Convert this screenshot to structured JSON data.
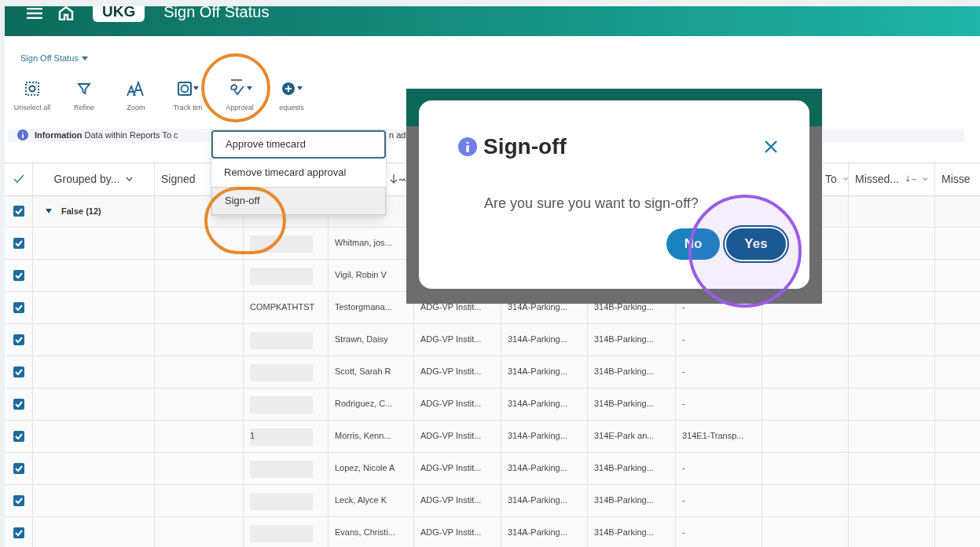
{
  "header": {
    "logo": "UKG",
    "title": "Sign Off Status"
  },
  "view_selector": {
    "label": "Sign Off Status"
  },
  "toolbar": [
    {
      "label": "Unselect all",
      "kind": "unselect",
      "menu": false
    },
    {
      "label": "Refine",
      "kind": "filter",
      "menu": false
    },
    {
      "label": "Zoom",
      "kind": "zoom",
      "menu": false
    },
    {
      "label": "Track tim",
      "kind": "track",
      "menu": true
    },
    {
      "label": "Approval",
      "kind": "approval",
      "menu": true
    },
    {
      "label": "equests",
      "kind": "add",
      "menu": true
    }
  ],
  "info_bar": {
    "text": "**Information** Data within Reports To c",
    "text_2": "n ad"
  },
  "approval_menu": [
    {
      "label": "Approve timecard",
      "focused": true,
      "selected": false
    },
    {
      "label": "Remove timecard approval",
      "focused": false,
      "selected": false
    },
    {
      "label": "Sign-off",
      "focused": false,
      "selected": true
    }
  ],
  "table": {
    "columns": [
      {
        "kind": "check"
      },
      {
        "kind": "text",
        "label": "Grouped by...",
        "chevron": true
      },
      {
        "kind": "text",
        "label": "Signed",
        "chevron": false
      },
      {
        "kind": "blank"
      },
      {
        "kind": "sort"
      },
      {
        "kind": "blank"
      },
      {
        "kind": "blank"
      },
      {
        "kind": "blank"
      },
      {
        "kind": "blank"
      },
      {
        "kind": "text",
        "label": "To",
        "chevron": true
      },
      {
        "kind": "text",
        "label": "Missed...",
        "chevron": true
      },
      {
        "kind": "text",
        "label": "Misse"
      }
    ],
    "group": {
      "label": "False (12)",
      "expanded": true,
      "checked": true
    },
    "rows": [
      {
        "checked": true,
        "redacted": true,
        "name": "Whitman, jos..."
      },
      {
        "checked": true,
        "redacted": true,
        "name": "Vigil, Robin V"
      },
      {
        "checked": true,
        "redacted": false,
        "code": "COMPKATHTST",
        "name": "Testorgmana...",
        "cells": [
          "ADG-VP Instit...",
          "314A-Parking...",
          "314B-Parking...",
          "-"
        ]
      },
      {
        "checked": true,
        "redacted": true,
        "name": "Strawn, Daisy",
        "cells": [
          "ADG-VP Instit...",
          "314A-Parking...",
          "314B-Parking...",
          "-"
        ]
      },
      {
        "checked": true,
        "redacted": true,
        "name": "Scott, Sarah R",
        "cells": [
          "ADG-VP Instit...",
          "314A-Parking...",
          "314B-Parking...",
          "-"
        ]
      },
      {
        "checked": true,
        "redacted": true,
        "name": "Rodriguez, C...",
        "cells": [
          "ADG-VP Instit...",
          "314A-Parking...",
          "314B-Parking...",
          "-"
        ]
      },
      {
        "checked": true,
        "redacted": true,
        "code": "1",
        "name": "Morris, Kenn...",
        "cells": [
          "ADG-VP Instit...",
          "314A-Parking...",
          "314E-Park an...",
          "314E1-Transp..."
        ]
      },
      {
        "checked": true,
        "redacted": true,
        "name": "Lopez, Nicole A",
        "cells": [
          "ADG-VP Instit...",
          "314A-Parking...",
          "314B-Parking...",
          "-"
        ]
      },
      {
        "checked": true,
        "redacted": true,
        "name": "Leck, Alyce K",
        "cells": [
          "ADG-VP Instit...",
          "314A-Parking...",
          "314B-Parking...",
          "-"
        ]
      },
      {
        "checked": true,
        "redacted": true,
        "name": "Evans, Christi...",
        "cells": [
          "ADG-VP Instit...",
          "314A-Parking...",
          "314B-Parking...",
          "-"
        ]
      }
    ]
  },
  "dialog": {
    "title": "Sign-off",
    "message": "Are you sure you want to sign-off?",
    "buttons": [
      {
        "label": "No",
        "focused": false
      },
      {
        "label": "Yes",
        "focused": true
      }
    ]
  },
  "annotations": [
    {
      "kind": "circle",
      "color": "#e8892c"
    },
    {
      "kind": "circle",
      "color": "#e8892c"
    },
    {
      "kind": "circle",
      "color": "#9b5de5"
    }
  ]
}
